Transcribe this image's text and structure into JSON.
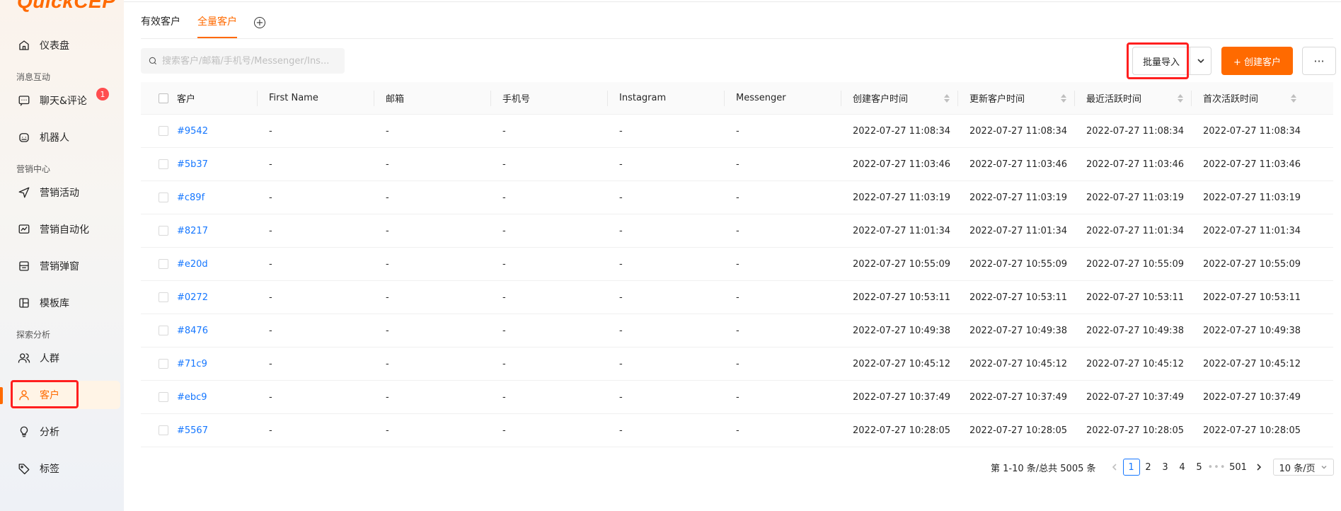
{
  "app": {
    "logo": "QuickCEP"
  },
  "sidebar": {
    "items": [
      {
        "label": "仪表盘",
        "icon": "dashboard-icon"
      },
      {
        "label": "聊天&评论",
        "icon": "chat-icon",
        "badge": "1"
      },
      {
        "label": "机器人",
        "icon": "robot-icon"
      },
      {
        "label": "营销活动",
        "icon": "send-icon"
      },
      {
        "label": "营销自动化",
        "icon": "automation-icon"
      },
      {
        "label": "营销弹窗",
        "icon": "popup-icon"
      },
      {
        "label": "模板库",
        "icon": "template-icon"
      },
      {
        "label": "人群",
        "icon": "users-icon"
      },
      {
        "label": "客户",
        "icon": "user-icon",
        "active": true
      },
      {
        "label": "分析",
        "icon": "bulb-icon"
      },
      {
        "label": "标签",
        "icon": "tag-icon"
      }
    ],
    "groups": [
      "消息互动",
      "营销中心",
      "探索分析"
    ]
  },
  "tabs": [
    {
      "label": "有效客户",
      "active": false
    },
    {
      "label": "全量客户",
      "active": true
    }
  ],
  "search": {
    "placeholder": "搜索客户/邮箱/手机号/Messenger/Ins..."
  },
  "toolbar": {
    "import_label": "批量导入",
    "create_label": "+ 创建客户",
    "more_label": "···"
  },
  "table": {
    "columns": [
      "客户",
      "First Name",
      "邮箱",
      "手机号",
      "Instagram",
      "Messenger",
      "创建客户时间",
      "更新客户时间",
      "最近活跃时间",
      "首次活跃时间"
    ],
    "rows": [
      [
        "#9542",
        "-",
        "-",
        "-",
        "-",
        "-",
        "2022-07-27 11:08:34",
        "2022-07-27 11:08:34",
        "2022-07-27 11:08:34",
        "2022-07-27 11:08:34"
      ],
      [
        "#5b37",
        "-",
        "-",
        "-",
        "-",
        "-",
        "2022-07-27 11:03:46",
        "2022-07-27 11:03:46",
        "2022-07-27 11:03:46",
        "2022-07-27 11:03:46"
      ],
      [
        "#c89f",
        "-",
        "-",
        "-",
        "-",
        "-",
        "2022-07-27 11:03:19",
        "2022-07-27 11:03:19",
        "2022-07-27 11:03:19",
        "2022-07-27 11:03:19"
      ],
      [
        "#8217",
        "-",
        "-",
        "-",
        "-",
        "-",
        "2022-07-27 11:01:34",
        "2022-07-27 11:01:34",
        "2022-07-27 11:01:34",
        "2022-07-27 11:01:34"
      ],
      [
        "#e20d",
        "-",
        "-",
        "-",
        "-",
        "-",
        "2022-07-27 10:55:09",
        "2022-07-27 10:55:09",
        "2022-07-27 10:55:09",
        "2022-07-27 10:55:09"
      ],
      [
        "#0272",
        "-",
        "-",
        "-",
        "-",
        "-",
        "2022-07-27 10:53:11",
        "2022-07-27 10:53:11",
        "2022-07-27 10:53:11",
        "2022-07-27 10:53:11"
      ],
      [
        "#8476",
        "-",
        "-",
        "-",
        "-",
        "-",
        "2022-07-27 10:49:38",
        "2022-07-27 10:49:38",
        "2022-07-27 10:49:38",
        "2022-07-27 10:49:38"
      ],
      [
        "#71c9",
        "-",
        "-",
        "-",
        "-",
        "-",
        "2022-07-27 10:45:12",
        "2022-07-27 10:45:12",
        "2022-07-27 10:45:12",
        "2022-07-27 10:45:12"
      ],
      [
        "#ebc9",
        "-",
        "-",
        "-",
        "-",
        "-",
        "2022-07-27 10:37:49",
        "2022-07-27 10:37:49",
        "2022-07-27 10:37:49",
        "2022-07-27 10:37:49"
      ],
      [
        "#5567",
        "-",
        "-",
        "-",
        "-",
        "-",
        "2022-07-27 10:28:05",
        "2022-07-27 10:28:05",
        "2022-07-27 10:28:05",
        "2022-07-27 10:28:05"
      ]
    ]
  },
  "pagination": {
    "summary": "第 1-10 条/总共 5005 条",
    "pages": [
      "1",
      "2",
      "3",
      "4",
      "5"
    ],
    "current": "1",
    "ellipsis": "•••",
    "last": "501",
    "page_size": "10 条/页"
  },
  "colors": {
    "accent": "#ff6a00",
    "link": "#1677ff",
    "highlight": "#ff1f1f"
  }
}
